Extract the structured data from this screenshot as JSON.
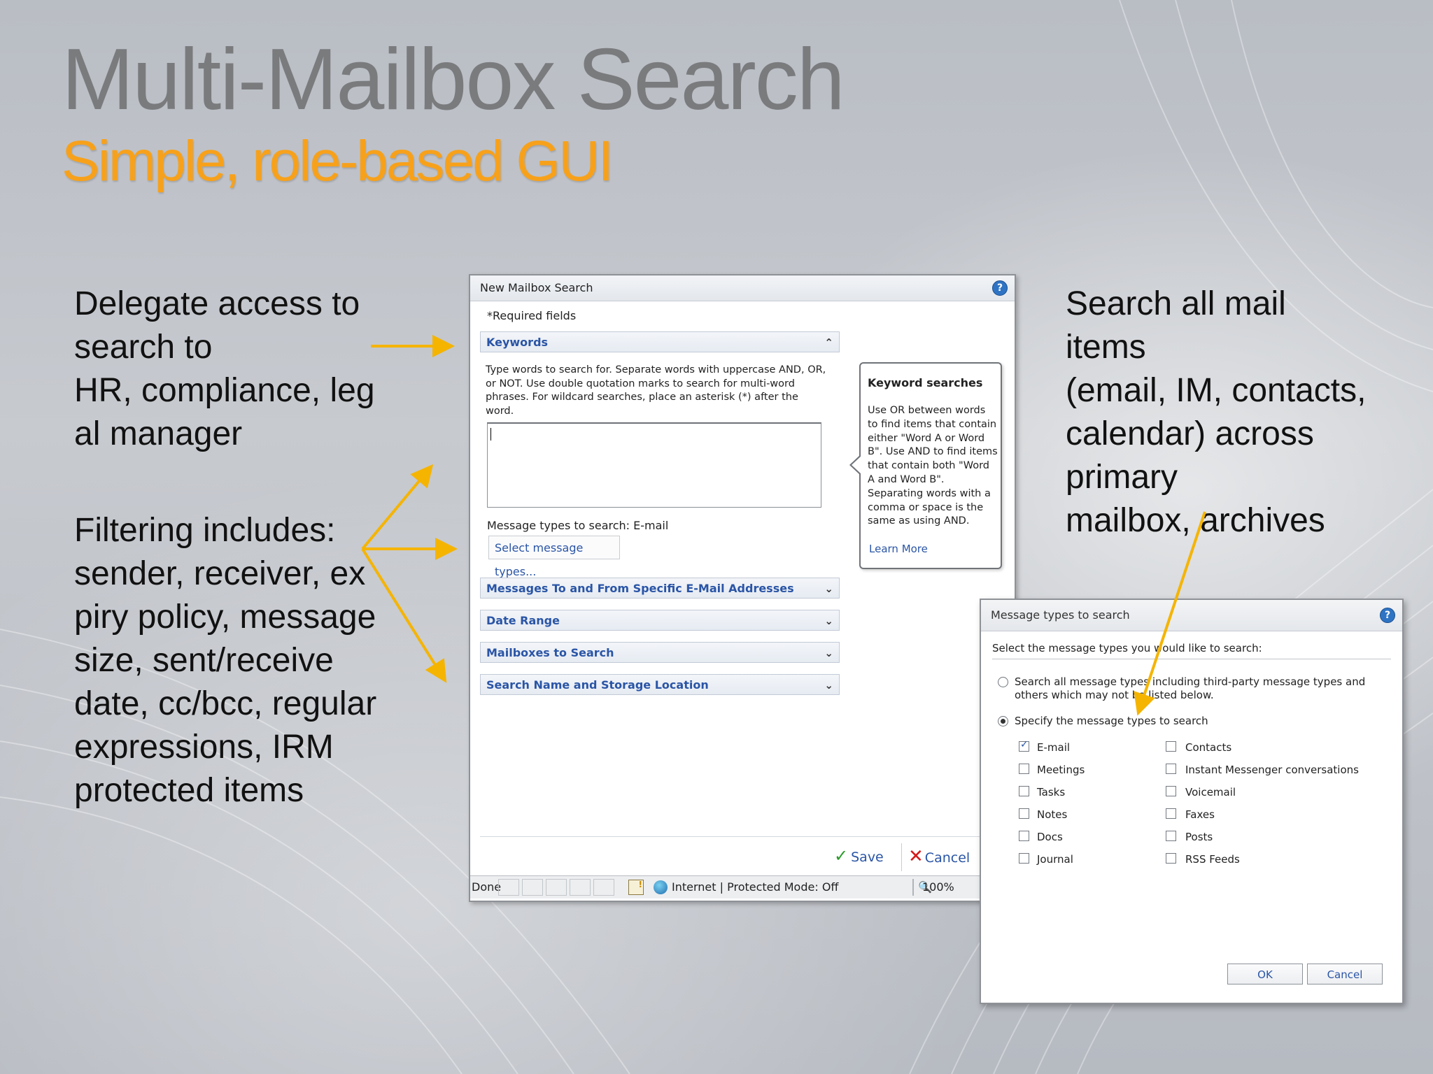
{
  "slide": {
    "title": "Multi-Mailbox Search",
    "subtitle": "Simple, role-based GUI"
  },
  "bullets": {
    "delegate": "Delegate access to\nsearch to\nHR, compliance, leg\nal manager",
    "filtering": "Filtering includes:\nsender, receiver, ex\npiry policy, message\nsize, sent/receive\ndate, cc/bcc, regular\nexpressions, IRM\nprotected items",
    "search_all": "Search all mail\nitems\n(email, IM, contacts,\n calendar) across\nprimary\nmailbox, archives"
  },
  "colors": {
    "title": "#7a7b7d",
    "subtitle": "#f7a11b",
    "arrow": "#f5b400",
    "link": "#2a55a6"
  },
  "new_search_dialog": {
    "title": "New Mailbox Search",
    "help_icon": "?",
    "required": "*Required fields",
    "sections": {
      "keywords": "Keywords",
      "addresses": "Messages To and From Specific E-Mail Addresses",
      "date_range": "Date Range",
      "mailboxes": "Mailboxes to Search",
      "storage": "Search Name and Storage Location"
    },
    "keyword_help": "Type words to search for. Separate words with uppercase AND, OR, or NOT. Use double quotation marks to search for multi-word phrases. For wildcard searches, place an asterisk (*) after the word.",
    "message_types_label": "Message types to search:  E-mail",
    "select_button": "Select message types...",
    "callout": {
      "title": "Keyword searches",
      "body": "Use OR between words to find items that contain either \"Word A or Word B\". Use AND to find items that contain both \"Word A and Word B\". Separating words with a comma or space is the same as using AND.",
      "link": "Learn More"
    },
    "save": "Save",
    "cancel": "Cancel",
    "status": {
      "done": "Done",
      "zone": "Internet | Protected Mode: Off",
      "zoom": "100%"
    }
  },
  "message_types_dialog": {
    "title": "Message types to search",
    "help_icon": "?",
    "prompt": "Select the message types you would like to search:",
    "option_all": "Search all message types including third-party message types and others which may not be listed below.",
    "option_specify": "Specify the message types to search",
    "left_types": [
      {
        "label": "E-mail",
        "checked": true
      },
      {
        "label": "Meetings",
        "checked": false
      },
      {
        "label": "Tasks",
        "checked": false
      },
      {
        "label": "Notes",
        "checked": false
      },
      {
        "label": "Docs",
        "checked": false
      },
      {
        "label": "Journal",
        "checked": false
      }
    ],
    "right_types": [
      {
        "label": "Contacts",
        "checked": false
      },
      {
        "label": "Instant Messenger conversations",
        "checked": false
      },
      {
        "label": "Voicemail",
        "checked": false
      },
      {
        "label": "Faxes",
        "checked": false
      },
      {
        "label": "Posts",
        "checked": false
      },
      {
        "label": "RSS Feeds",
        "checked": false
      }
    ],
    "ok": "OK",
    "cancel": "Cancel"
  }
}
